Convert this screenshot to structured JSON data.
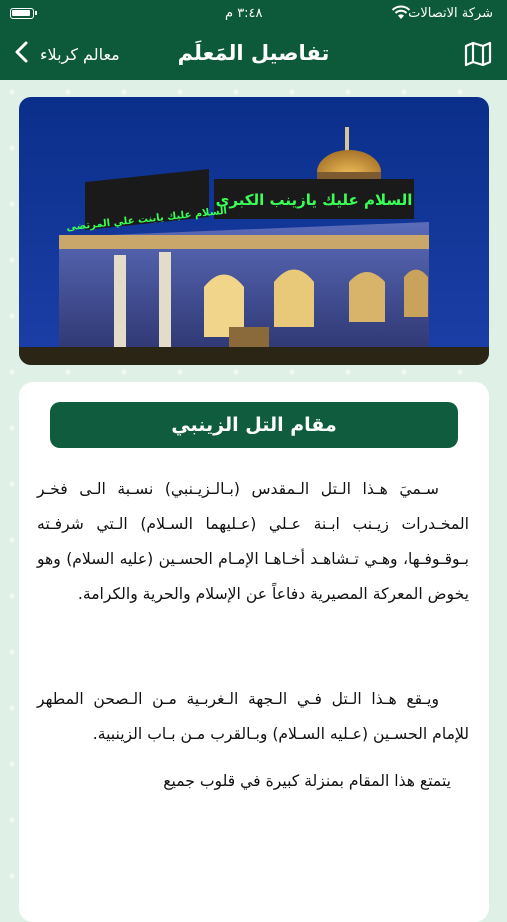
{
  "status": {
    "carrier": "شركة الاتصالات",
    "time": "٣:٤٨ م"
  },
  "nav": {
    "back_label": "معالم كربلاء",
    "title": "تفاصيل المَعلَم",
    "map_icon": "map-icon"
  },
  "photo": {
    "sign_main": "السلام عليك يازينب الكبرى",
    "sign_side": "السلام عليك يابنت علي المرتضى"
  },
  "landmark": {
    "name": "مقام التل الزينبي",
    "paragraphs": [
      "سـميَ هـذا الـتل الـمقدس (بـالـزيـنبي) نسـبة الـى فخـر المخـدرات زيـنب ابـنة عـلي (عـليهما السـلام) الـتي شرفـته بـوقـوفـها، وهـي تـشاهـد أخـاهـا الإمـام الحسـين (عليه السلام) وهو يخوض المعركة المصيرية دفاعاً عن الإسلام والحرية والكرامة.",
      "ويـقع هـذا الـتل فـي الـجهة الـغربـية مـن الـصحن المطهر للإمام الحسـين (عـليه السـلام) وبـالقرب مـن بـاب الزينبية.",
      "يتمتع هذا المقام بمنزلة كبيرة في قلوب جميع"
    ]
  },
  "colors": {
    "header": "#0d5a3a",
    "pill": "#0f5d3e",
    "background": "#dff1e7"
  }
}
